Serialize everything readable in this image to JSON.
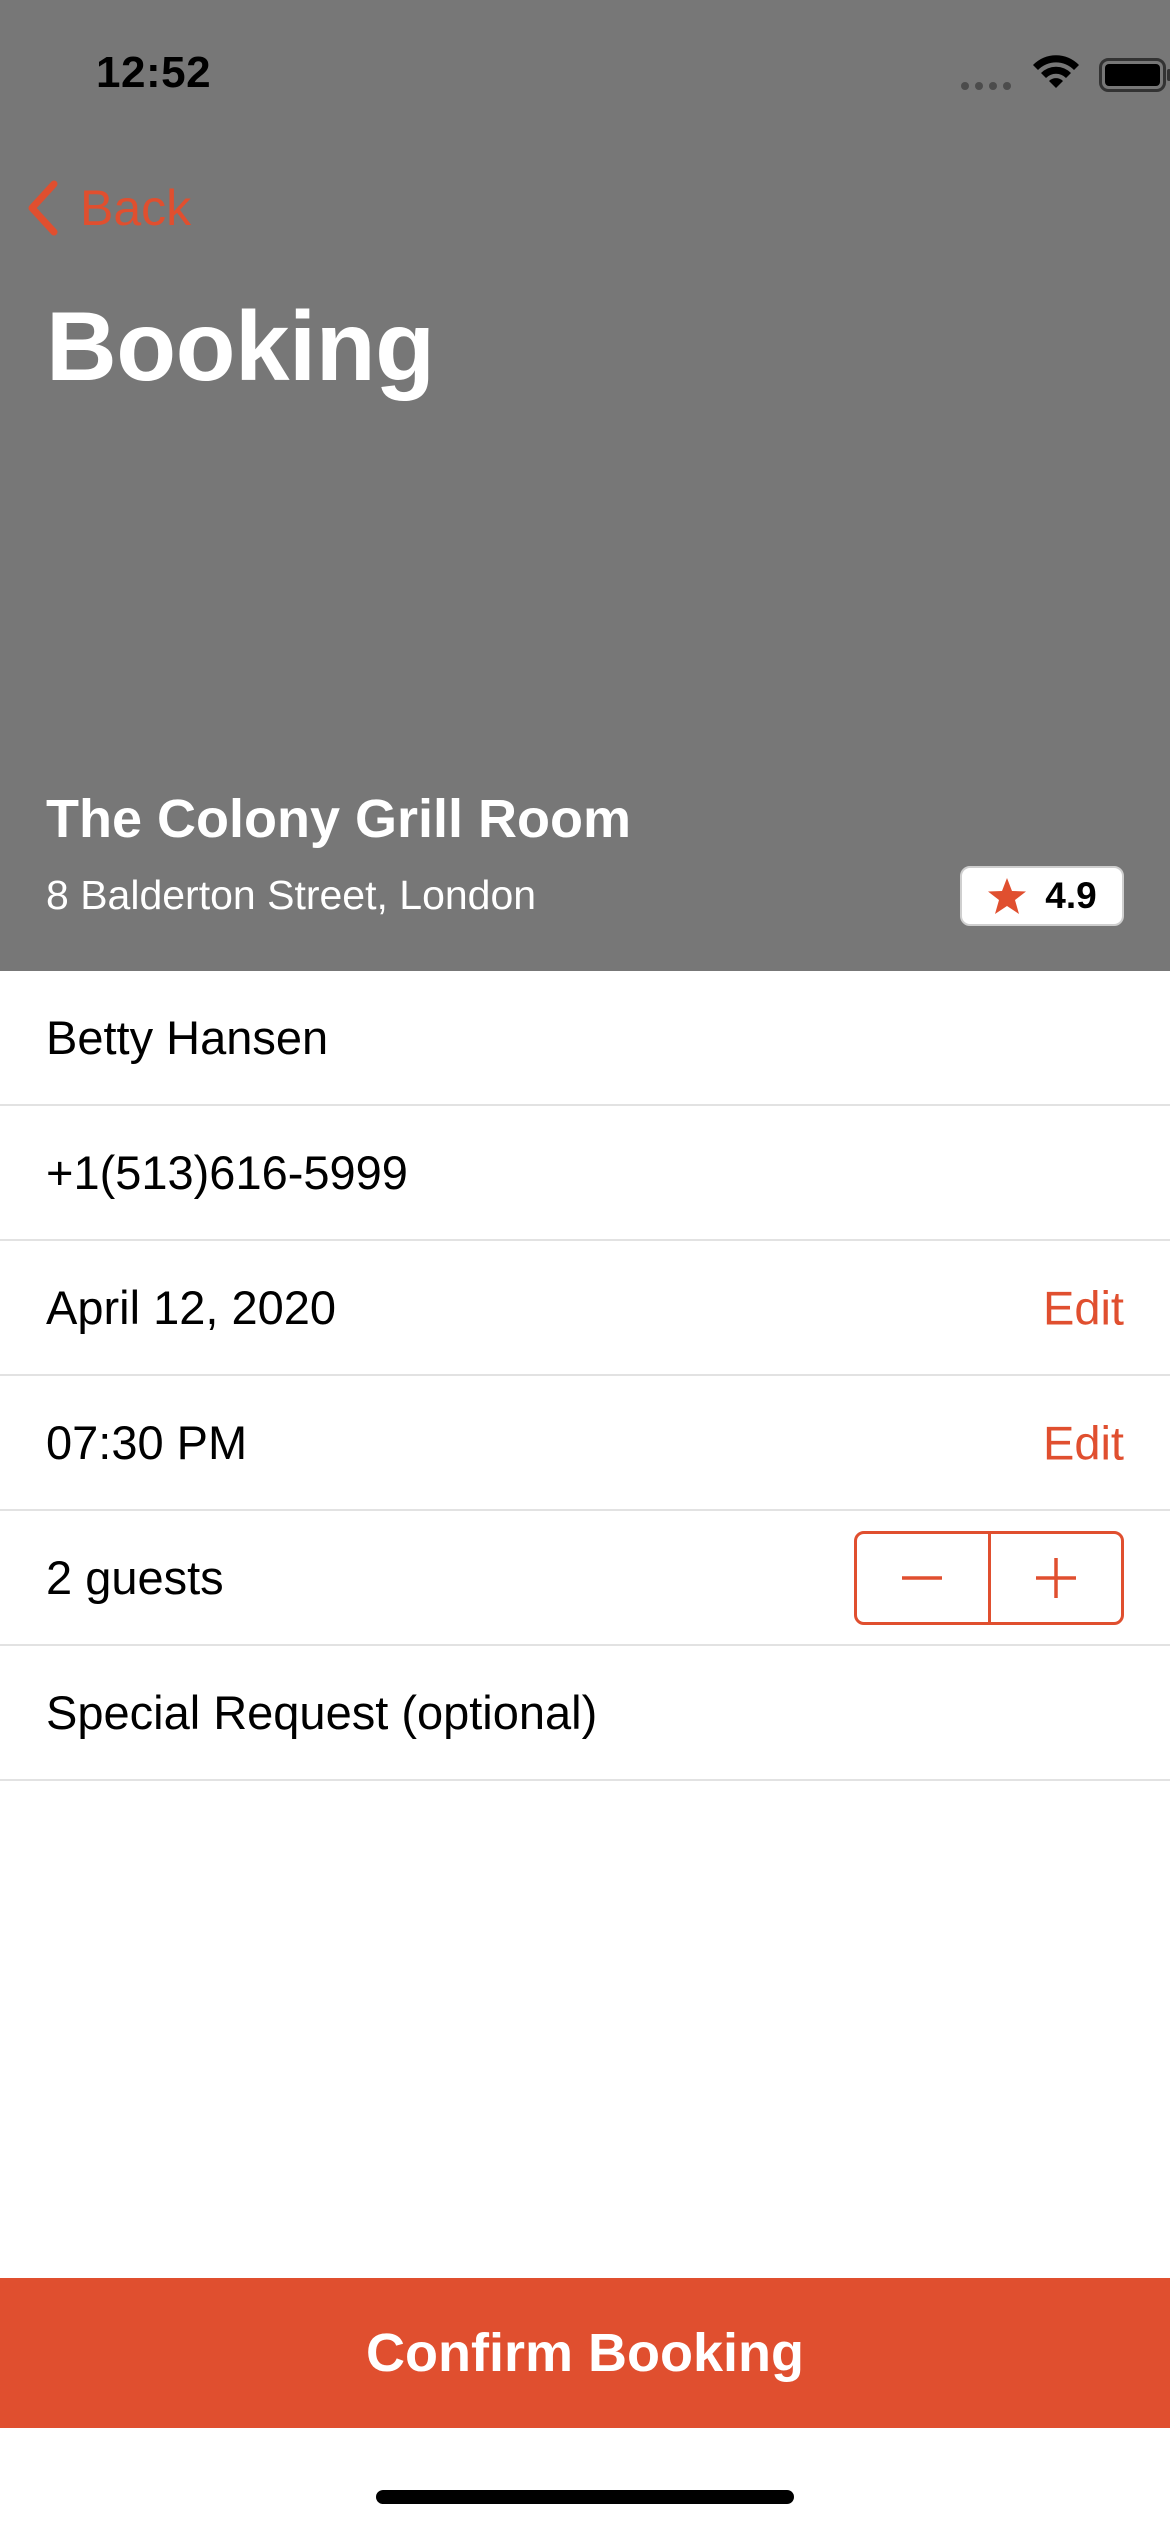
{
  "status_bar": {
    "time": "12:52"
  },
  "nav": {
    "back_label": "Back",
    "title": "Booking"
  },
  "restaurant": {
    "name": "The Colony Grill Room",
    "address": "8 Balderton Street, London",
    "rating": "4.9"
  },
  "form": {
    "name": "Betty Hansen",
    "phone": "+1(513)616-5999",
    "date": "April 12, 2020",
    "date_edit_label": "Edit",
    "time": "07:30 PM",
    "time_edit_label": "Edit",
    "guests": "2 guests",
    "special_request_placeholder": "Special Request (optional)"
  },
  "confirm_label": "Confirm Booking",
  "icons": {
    "back": "chevron-left-icon",
    "rating": "star-icon",
    "decrement": "minus-icon",
    "increment": "plus-icon",
    "wifi": "wifi-icon",
    "battery": "battery-icon",
    "signal": "signal-icon"
  },
  "colors": {
    "accent": "#e04f2f",
    "header_background": "#777777",
    "divider": "#e2e2e2"
  }
}
